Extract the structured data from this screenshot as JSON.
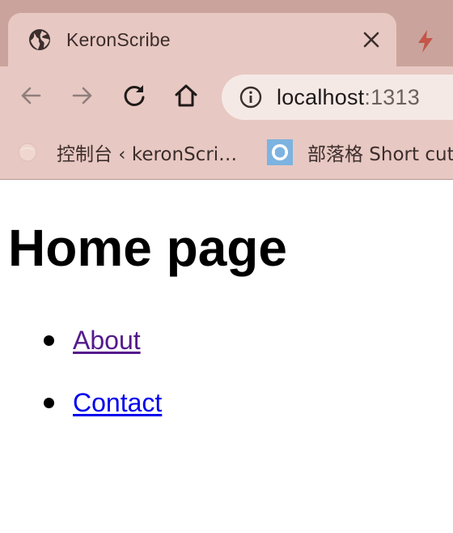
{
  "browser": {
    "tab": {
      "title": "KeronScribe",
      "favicon": "globe-icon",
      "close": "✕"
    },
    "next_tab_icon": "lightning-icon",
    "toolbar": {
      "back_icon": "back-arrow-icon",
      "forward_icon": "forward-arrow-icon",
      "reload_icon": "reload-icon",
      "home_icon": "home-icon"
    },
    "address_bar": {
      "host": "localhost",
      "port": ":1313",
      "icon": "info-icon"
    },
    "bookmarks": [
      {
        "label": "控制台 ‹ keronScri…",
        "icon": "wordpress-icon"
      },
      {
        "label": "部落格 Short cut",
        "icon": "bookmark-favicon"
      }
    ]
  },
  "page": {
    "heading": "Home page",
    "links": [
      {
        "label": "About",
        "visited": true
      },
      {
        "label": "Contact",
        "visited": false
      }
    ]
  },
  "colors": {
    "chrome": "#e8c8c2",
    "tabstrip": "#caa49c",
    "omnibox": "#f5e9e6",
    "link_visited": "#551a8b",
    "link_unvisited": "#0000ee"
  }
}
